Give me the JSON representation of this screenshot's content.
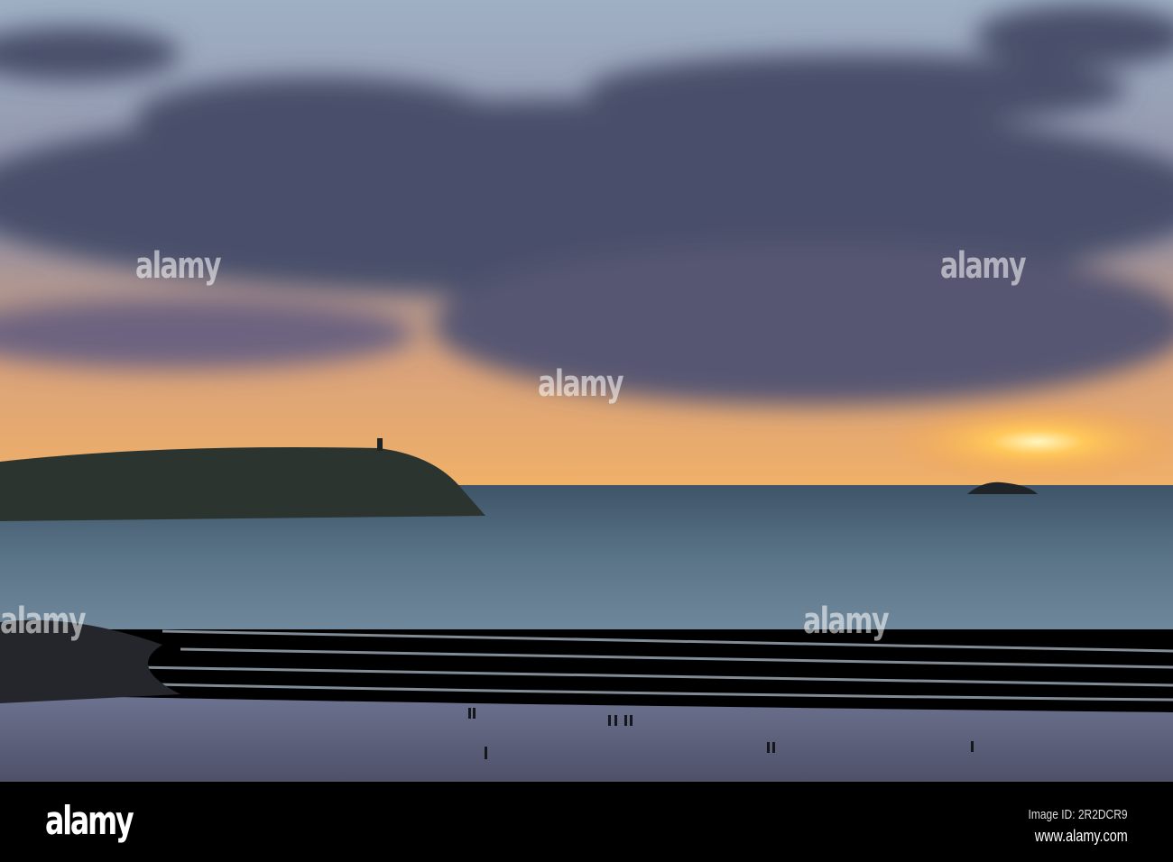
{
  "watermark": {
    "text": "alamy"
  },
  "footer": {
    "logo": "alamy",
    "image_id": "Image ID: 2R2DCR9",
    "url": "www.alamy.com"
  },
  "colors": {
    "sky_top": "#9fb0c4",
    "cloud": "#4a4f6b",
    "sunset": "#f3b062",
    "sea": "#5a7487",
    "beach": "#5d5e78"
  }
}
